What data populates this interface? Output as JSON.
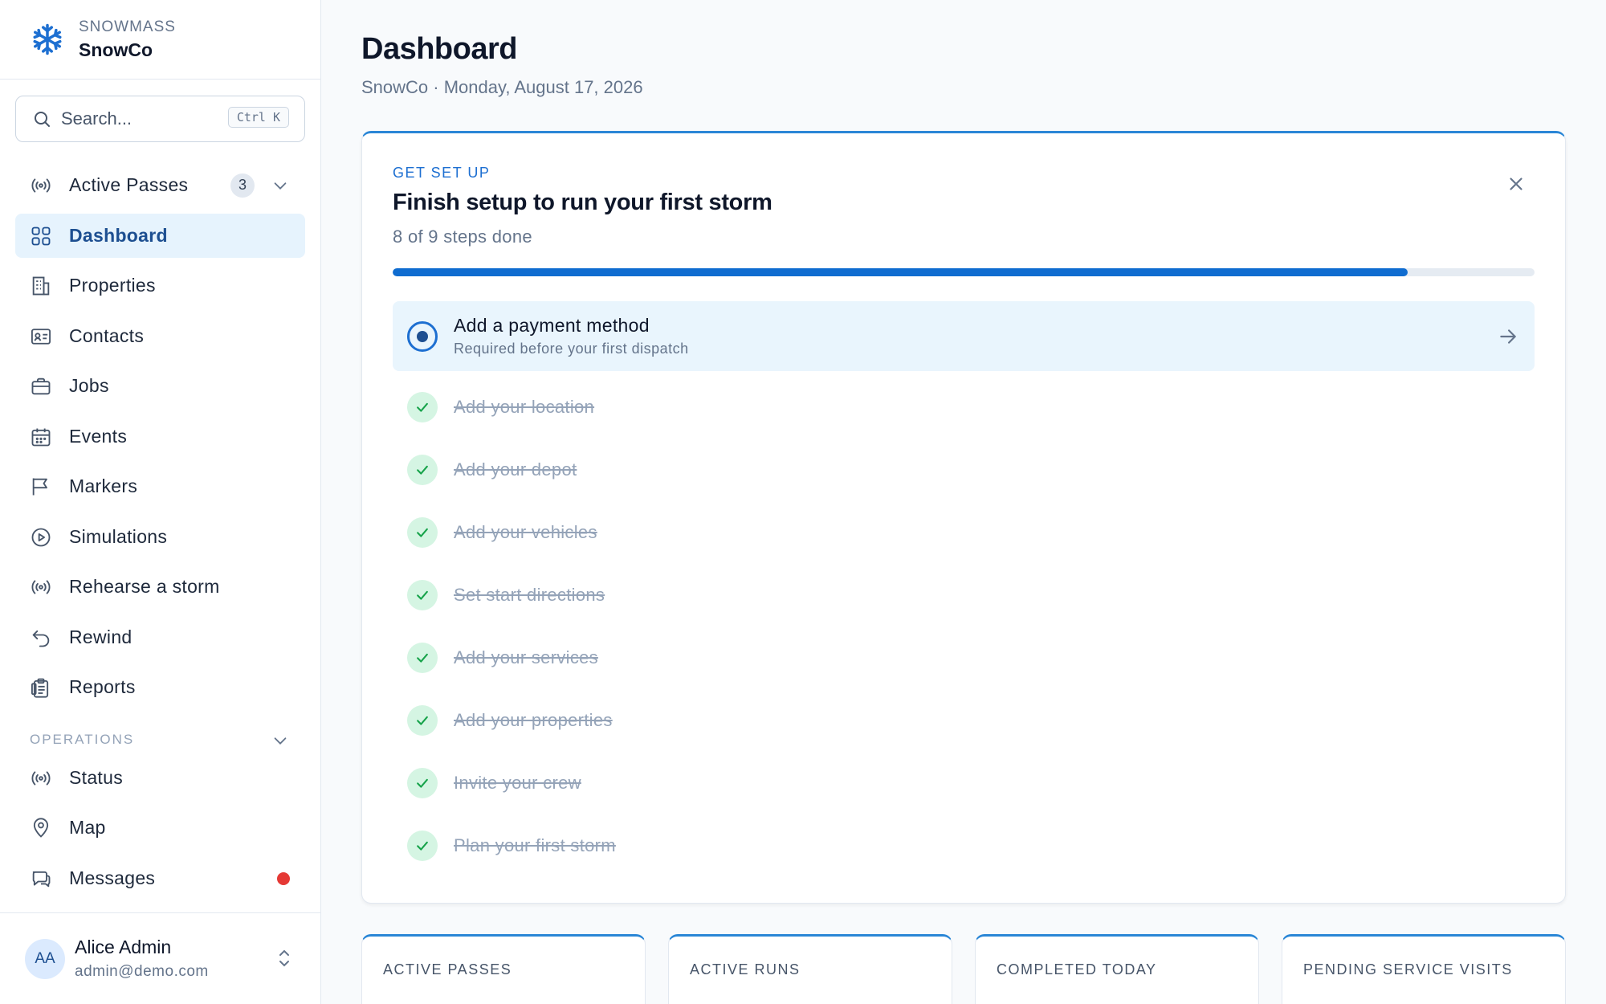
{
  "brand": {
    "org": "SNOWMASS",
    "name": "SnowCo"
  },
  "search": {
    "placeholder": "Search...",
    "shortcut": "Ctrl K"
  },
  "nav": [
    {
      "label": "Active Passes",
      "icon": "broadcast-icon",
      "badge": "3"
    },
    {
      "label": "Dashboard",
      "icon": "grid-icon",
      "active": true
    },
    {
      "label": "Properties",
      "icon": "building-icon"
    },
    {
      "label": "Contacts",
      "icon": "contact-card-icon"
    },
    {
      "label": "Jobs",
      "icon": "briefcase-icon"
    },
    {
      "label": "Events",
      "icon": "calendar-icon"
    },
    {
      "label": "Markers",
      "icon": "flag-icon"
    },
    {
      "label": "Simulations",
      "icon": "play-circle-icon"
    },
    {
      "label": "Rehearse a storm",
      "icon": "broadcast-icon"
    },
    {
      "label": "Rewind",
      "icon": "undo-icon"
    },
    {
      "label": "Reports",
      "icon": "clipboard-icon"
    }
  ],
  "operations": {
    "label": "OPERATIONS",
    "items": [
      {
        "label": "Status",
        "icon": "broadcast-icon"
      },
      {
        "label": "Map",
        "icon": "map-pin-icon"
      },
      {
        "label": "Messages",
        "icon": "chat-icon",
        "unread": true
      }
    ]
  },
  "user": {
    "initials": "AA",
    "name": "Alice Admin",
    "email": "admin@demo.com"
  },
  "page": {
    "title": "Dashboard",
    "subtitle": "SnowCo · Monday, August 17, 2026"
  },
  "setup": {
    "eyebrow": "GET SET UP",
    "title": "Finish setup to run your first storm",
    "progress_text": "8 of 9 steps done",
    "progress_fraction": 0.889,
    "current_step": {
      "title": "Add a payment method",
      "description": "Required before your first dispatch"
    },
    "completed_steps": [
      "Add your location",
      "Add your depot",
      "Add your vehicles",
      "Set start directions",
      "Add your services",
      "Add your properties",
      "Invite your crew",
      "Plan your first storm"
    ]
  },
  "stats": [
    {
      "label": "ACTIVE PASSES",
      "value": ""
    },
    {
      "label": "ACTIVE RUNS",
      "value": ""
    },
    {
      "label": "COMPLETED TODAY",
      "value": ""
    },
    {
      "label": "PENDING SERVICE VISITS",
      "value": ""
    }
  ],
  "colors": {
    "accent": "#1d6fd1",
    "active_bg": "#e6f3fd",
    "success": "#16a34a",
    "alert": "#e53935"
  }
}
